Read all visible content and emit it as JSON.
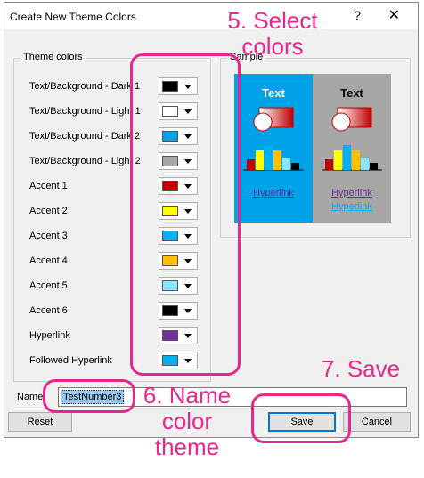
{
  "window": {
    "title": "Create New Theme Colors",
    "help": "?",
    "close": "✕"
  },
  "theme_colors": {
    "group_label": "Theme colors",
    "rows": [
      {
        "label": "Text/Background - Dark 1",
        "color": "#000000"
      },
      {
        "label": "Text/Background - Light 1",
        "color": "#ffffff"
      },
      {
        "label": "Text/Background - Dark 2",
        "color": "#00a2e8"
      },
      {
        "label": "Text/Background - Light 2",
        "color": "#a6a6a6"
      },
      {
        "label": "Accent 1",
        "color": "#c00000"
      },
      {
        "label": "Accent 2",
        "color": "#ffff00"
      },
      {
        "label": "Accent 3",
        "color": "#00b0f0"
      },
      {
        "label": "Accent 4",
        "color": "#ffc000"
      },
      {
        "label": "Accent 5",
        "color": "#8ae6ff"
      },
      {
        "label": "Accent 6",
        "color": "#000000"
      },
      {
        "label": "Hyperlink",
        "color": "#7030a0"
      },
      {
        "label": "Followed Hyperlink",
        "color": "#00b0f0"
      }
    ]
  },
  "sample": {
    "group_label": "Sample",
    "dark_panel": {
      "text": "Text",
      "hyperlink": "Hyperlink"
    },
    "light_panel": {
      "text": "Text",
      "hyperlink": "Hyperlink",
      "followed_hyperlink": "Hyperlink"
    }
  },
  "name": {
    "label": "Name:",
    "value": "TestNumber3"
  },
  "buttons": {
    "reset": "Reset",
    "save": "Save",
    "cancel": "Cancel"
  },
  "annotations": {
    "select": "5. Select colors",
    "name": "6. Name color theme",
    "save": "7. Save"
  }
}
